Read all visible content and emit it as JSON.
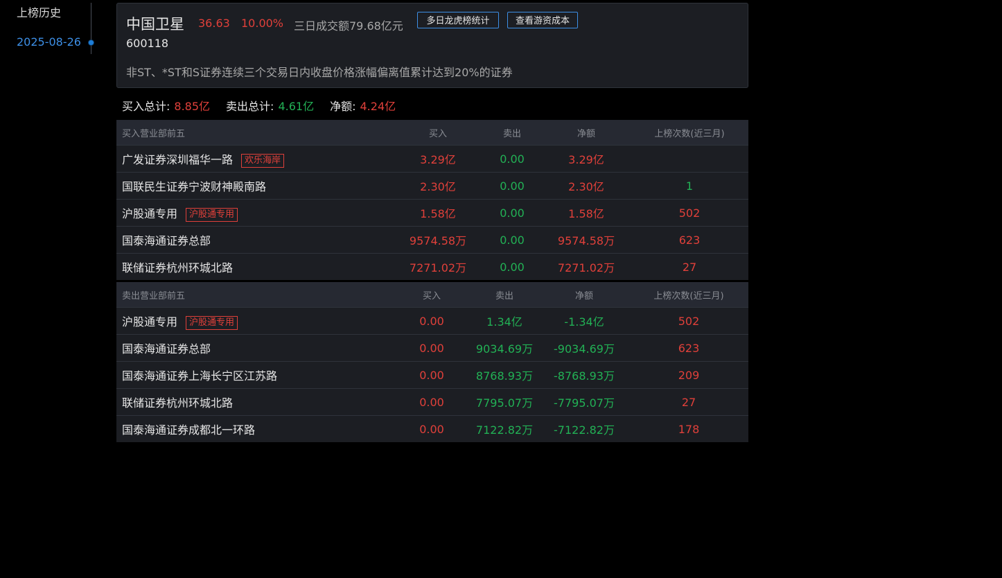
{
  "sidebar": {
    "title": "上榜历史",
    "dates": [
      "2025-08-26"
    ]
  },
  "stock": {
    "name": "中国卫星",
    "price": "36.63",
    "change_pct": "10.00%",
    "turnover": "三日成交额79.68亿元",
    "code": "600118",
    "reason": "非ST、*ST和S证券连续三个交易日内收盘价格涨幅偏离值累计达到20%的证券"
  },
  "buttons": {
    "multi_day": "多日龙虎榜统计",
    "cost": "查看游资成本"
  },
  "totals": {
    "buy_label": "买入总计:",
    "buy_value": "8.85亿",
    "sell_label": "卖出总计:",
    "sell_value": "4.61亿",
    "net_label": "净额:",
    "net_value": "4.24亿"
  },
  "colors": {
    "up": "#e0403a",
    "down": "#22b155",
    "accent": "#3d8fe6"
  },
  "buy_table": {
    "headers": [
      "买入营业部前五",
      "买入",
      "卖出",
      "净额",
      "上榜次数(近三月)"
    ],
    "rows": [
      {
        "name": "广发证券深圳福华一路",
        "tag": "欢乐海岸",
        "buy": "3.29亿",
        "sell": "0.00",
        "net": "3.29亿",
        "count": "",
        "count_color": "red"
      },
      {
        "name": "国联民生证券宁波财神殿南路",
        "tag": "",
        "buy": "2.30亿",
        "sell": "0.00",
        "net": "2.30亿",
        "count": "1",
        "count_color": "green"
      },
      {
        "name": "沪股通专用",
        "tag": "沪股通专用",
        "buy": "1.58亿",
        "sell": "0.00",
        "net": "1.58亿",
        "count": "502",
        "count_color": "red"
      },
      {
        "name": "国泰海通证券总部",
        "tag": "",
        "buy": "9574.58万",
        "sell": "0.00",
        "net": "9574.58万",
        "count": "623",
        "count_color": "red"
      },
      {
        "name": "联储证券杭州环城北路",
        "tag": "",
        "buy": "7271.02万",
        "sell": "0.00",
        "net": "7271.02万",
        "count": "27",
        "count_color": "red"
      }
    ]
  },
  "sell_table": {
    "headers": [
      "卖出营业部前五",
      "买入",
      "卖出",
      "净额",
      "上榜次数(近三月)"
    ],
    "rows": [
      {
        "name": "沪股通专用",
        "tag": "沪股通专用",
        "buy": "0.00",
        "sell": "1.34亿",
        "net": "-1.34亿",
        "count": "502"
      },
      {
        "name": "国泰海通证券总部",
        "tag": "",
        "buy": "0.00",
        "sell": "9034.69万",
        "net": "-9034.69万",
        "count": "623"
      },
      {
        "name": "国泰海通证券上海长宁区江苏路",
        "tag": "",
        "buy": "0.00",
        "sell": "8768.93万",
        "net": "-8768.93万",
        "count": "209"
      },
      {
        "name": "联储证券杭州环城北路",
        "tag": "",
        "buy": "0.00",
        "sell": "7795.07万",
        "net": "-7795.07万",
        "count": "27"
      },
      {
        "name": "国泰海通证券成都北一环路",
        "tag": "",
        "buy": "0.00",
        "sell": "7122.82万",
        "net": "-7122.82万",
        "count": "178"
      }
    ]
  }
}
